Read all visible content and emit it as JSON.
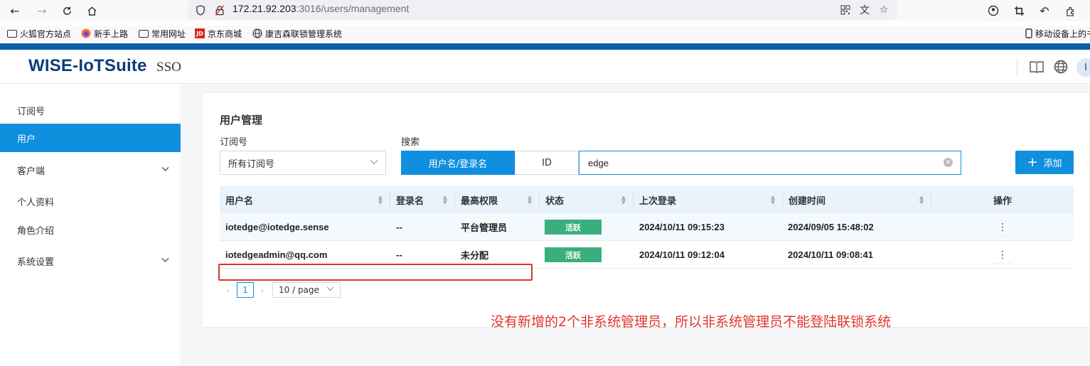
{
  "browser": {
    "url_host": "172.21.92.203",
    "url_rest": ":3016/users/management",
    "bookmarks": [
      "火狐官方站点",
      "新手上路",
      "常用网址",
      "京东商城",
      "康吉森联锁管理系统"
    ],
    "mobile_bookmarks": "移动设备上的书签"
  },
  "header": {
    "logo": "WISE-IoTSuite",
    "product": "SSO",
    "avatar": "I"
  },
  "sidebar": {
    "items": [
      {
        "label": "订阅号"
      },
      {
        "label": "用户"
      },
      {
        "label": "客户端"
      },
      {
        "label": "个人资料"
      },
      {
        "label": "角色介绍"
      },
      {
        "label": "系统设置"
      }
    ]
  },
  "main": {
    "title": "用户管理",
    "subscription_label": "订阅号",
    "subscription_value": "所有订阅号",
    "search_label": "搜索",
    "search_by_name": "用户名/登录名",
    "search_by_id": "ID",
    "search_value": "edge",
    "add_button": "添加"
  },
  "table": {
    "columns": [
      "用户名",
      "登录名",
      "最高权限",
      "状态",
      "上次登录",
      "创建时间",
      "操作"
    ],
    "rows": [
      {
        "username": "iotedge@iotedge.sense",
        "login": "--",
        "role": "平台管理员",
        "status": "活跃",
        "last_login": "2024/10/11 09:15:23",
        "created": "2024/09/05 15:48:02"
      },
      {
        "username": "iotedgeadmin@qq.com",
        "login": "--",
        "role": "未分配",
        "status": "活跃",
        "last_login": "2024/10/11 09:12:04",
        "created": "2024/10/11 09:08:41"
      }
    ]
  },
  "pagination": {
    "current_page": "1",
    "page_size": "10 / page"
  },
  "annotation": {
    "text": "没有新增的2个非系统管理员，所以非系统管理员不能登陆联锁系统"
  },
  "colors": {
    "primary": "#0f8fdd",
    "status_active": "#3aae7c",
    "annotation": "#e0342d",
    "brand": "#0b3d7a"
  }
}
